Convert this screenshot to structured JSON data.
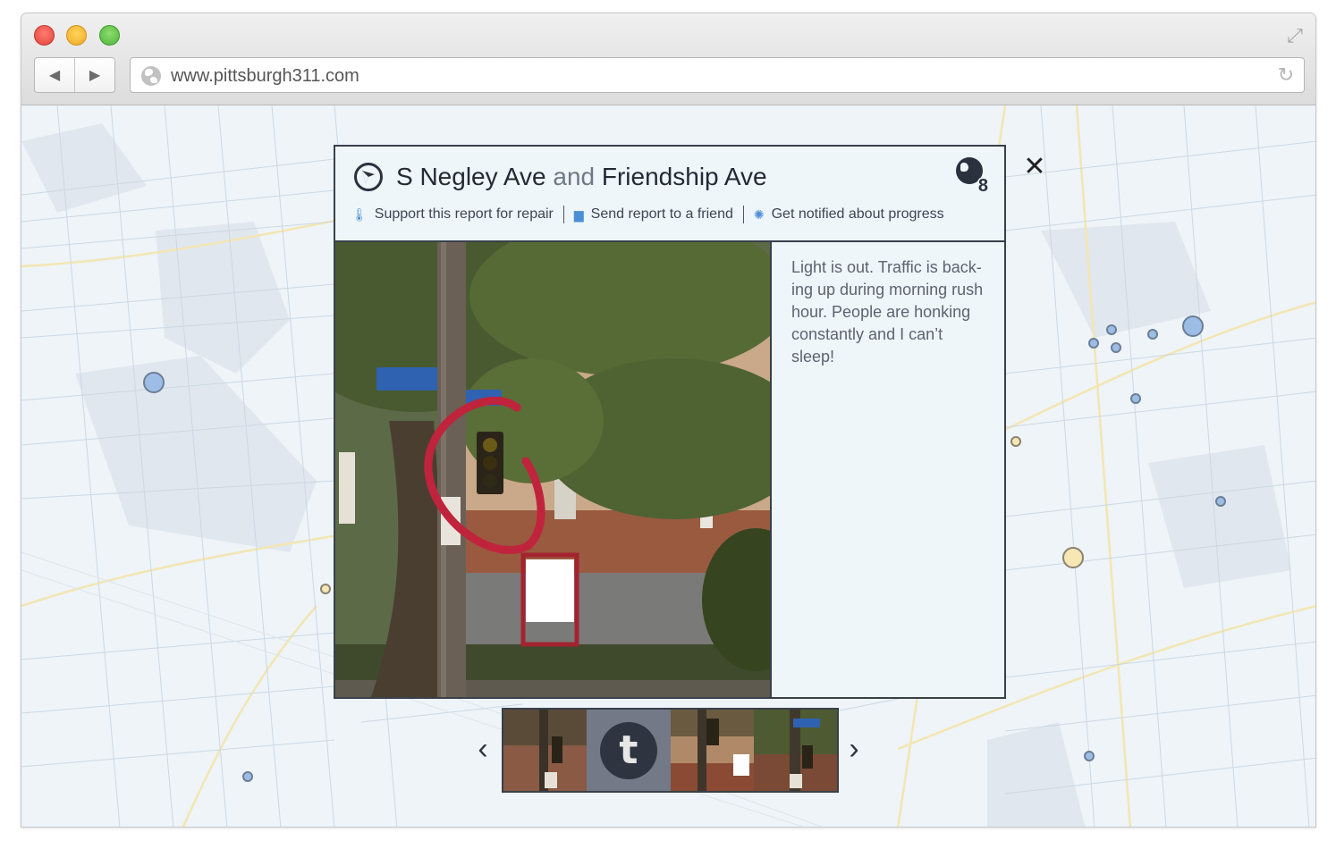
{
  "browser": {
    "url": "www.pittsburgh311.com",
    "back_label": "◀",
    "forward_label": "▶",
    "reload_glyph": "↻",
    "fullscreen_glyph": "⤢"
  },
  "report": {
    "street_1": "S Negley Ave",
    "joiner": "and",
    "street_2": "Friendship Ave",
    "badge_count": "8",
    "actions": {
      "support": "Support this report for repair",
      "send": "Send report to a friend",
      "notify": "Get notified about progress"
    },
    "description": "Light is out. Traffic is back-ing up during morning rush hour. People are honking constantly and I can’t sleep!",
    "close_glyph": "✕"
  },
  "carousel": {
    "prev_glyph": "‹",
    "next_glyph": "›",
    "avatar_letter": "t"
  },
  "colors": {
    "map_background": "#eef4f8",
    "panel_background": "#eff6fa",
    "border": "#38404a",
    "marker_blue": "#9dbde6",
    "marker_yellow": "#f6e7b4",
    "annotation_red": "#c0243c"
  },
  "icons": {
    "compass": "compass-icon",
    "badge": "globe-count-icon",
    "support": "thermometer-icon",
    "send": "image-envelope-icon",
    "notify": "spinner-icon",
    "close": "close-icon"
  }
}
